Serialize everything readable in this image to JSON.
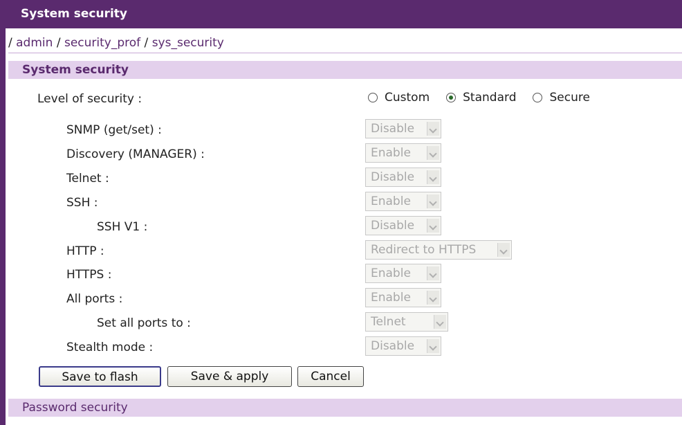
{
  "window": {
    "title": "System security"
  },
  "breadcrumb": {
    "sep": "/",
    "items": [
      "admin",
      "security_prof",
      "sys_security"
    ]
  },
  "section": {
    "title": "System security"
  },
  "security_level": {
    "label": "Level of security :",
    "options": [
      "Custom",
      "Standard",
      "Secure"
    ],
    "selected": "Standard"
  },
  "settings": [
    {
      "label": "SNMP (get/set) :",
      "value": "Disable"
    },
    {
      "label": "Discovery (MANAGER) :",
      "value": "Enable"
    },
    {
      "label": "Telnet :",
      "value": "Disable"
    },
    {
      "label": "SSH :",
      "value": "Enable"
    },
    {
      "label": "SSH V1 :",
      "value": "Disable"
    },
    {
      "label": "HTTP :",
      "value": "Redirect to HTTPS"
    },
    {
      "label": "HTTPS :",
      "value": "Enable"
    },
    {
      "label": "All ports :",
      "value": "Enable"
    },
    {
      "label": "Set all ports to :",
      "value": "Telnet"
    },
    {
      "label": "Stealth mode :",
      "value": "Disable"
    }
  ],
  "buttons": {
    "save_flash": "Save to flash",
    "save_apply": "Save & apply",
    "cancel": "Cancel"
  },
  "next_section": {
    "title": "Password security"
  },
  "colors": {
    "accent": "#5a2a6e",
    "section_bg": "#e3d0ec"
  }
}
